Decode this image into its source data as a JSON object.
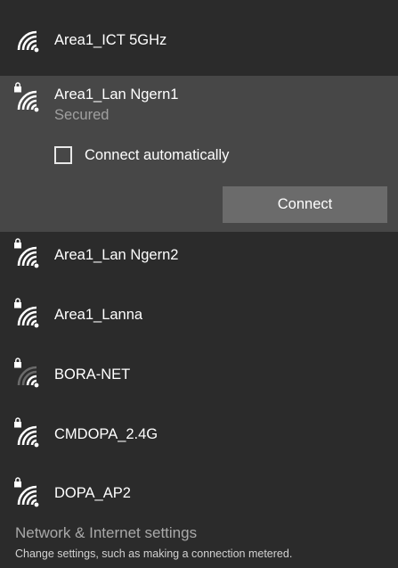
{
  "networks": [
    {
      "ssid": "Area1_ICT 5GHz",
      "secured": false,
      "signal": 4,
      "icon": "wifi-icon"
    },
    {
      "ssid": "Area1_Lan Ngern1",
      "secured": true,
      "signal": 4,
      "icon": "wifi-secured-icon",
      "status": "Secured",
      "expanded": true
    },
    {
      "ssid": "Area1_Lan Ngern2",
      "secured": true,
      "signal": 4,
      "icon": "wifi-secured-icon"
    },
    {
      "ssid": "Area1_Lanna",
      "secured": true,
      "signal": 4,
      "icon": "wifi-secured-icon"
    },
    {
      "ssid": "BORA-NET",
      "secured": true,
      "signal": 2,
      "icon": "wifi-secured-icon"
    },
    {
      "ssid": "CMDOPA_2.4G",
      "secured": true,
      "signal": 4,
      "icon": "wifi-secured-icon"
    },
    {
      "ssid": "DOPA_AP2",
      "secured": true,
      "signal": 4,
      "icon": "wifi-secured-icon"
    }
  ],
  "expanded": {
    "status": "Secured",
    "auto_connect_label": "Connect automatically",
    "auto_connect_checked": false,
    "connect_label": "Connect"
  },
  "footer": {
    "settings_label": "Network & Internet settings",
    "settings_description": "Change settings, such as making a connection metered."
  },
  "colors": {
    "background": "#2b2b2b",
    "selected_background": "#474747",
    "button_background": "#6b6b6b",
    "text": "#ffffff",
    "muted_text": "#a0a0a0"
  }
}
